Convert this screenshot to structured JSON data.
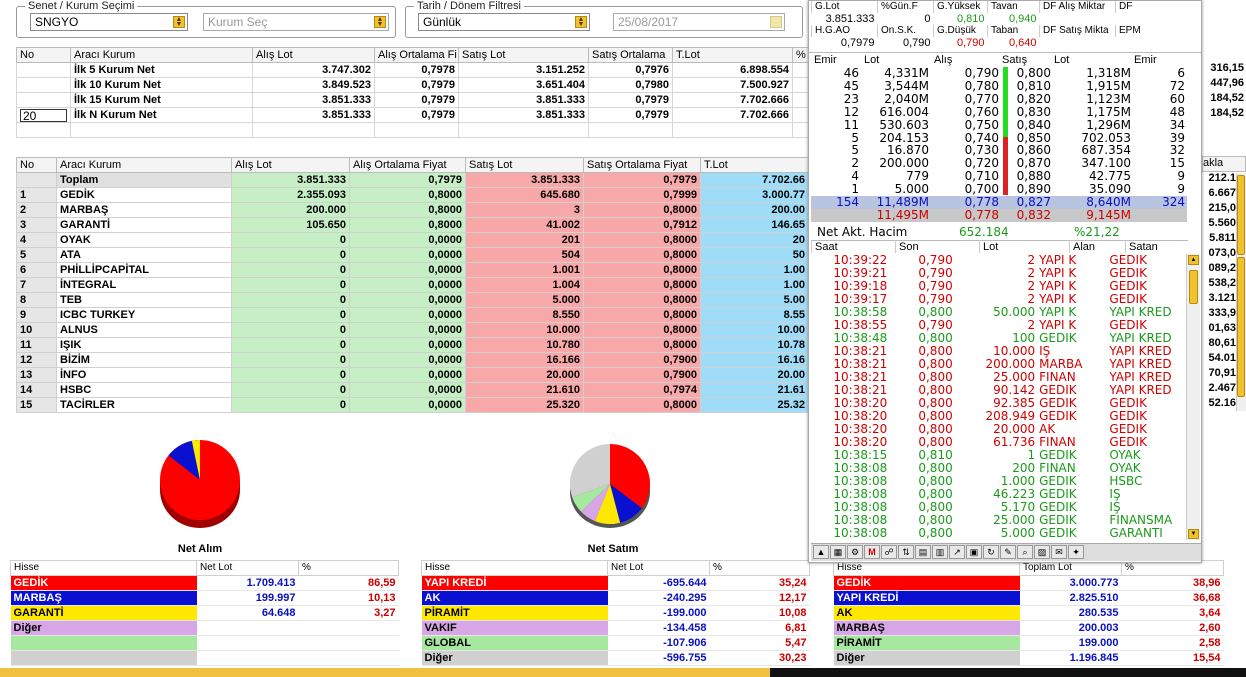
{
  "filters": {
    "senet_legend": "Senet / Kurum Seçimi",
    "senet_value": "SNGYO",
    "kurum_placeholder": "Kurum Seç",
    "tarih_legend": "Tarih / Dönem Filtresi",
    "period_value": "Günlük",
    "date_value": "25/08/2017"
  },
  "top_table": {
    "headers": [
      "No",
      "Aracı Kurum",
      "Alış Lot",
      "Alış Ortalama Fi",
      "Satış Lot",
      "Satış Ortalama",
      "T.Lot",
      "%"
    ],
    "n_input": "20",
    "rows": [
      {
        "no": "",
        "name": "İlk 5 Kurum Net",
        "al": "3.747.302",
        "alo": "0,7978",
        "sat": "3.151.252",
        "sato": "0,7976",
        "tlot": "6.898.554"
      },
      {
        "no": "",
        "name": "İlk 10 Kurum Net",
        "al": "3.849.523",
        "alo": "0,7979",
        "sat": "3.651.404",
        "sato": "0,7980",
        "tlot": "7.500.927"
      },
      {
        "no": "",
        "name": "İlk 15 Kurum Net",
        "al": "3.851.333",
        "alo": "0,7979",
        "sat": "3.851.333",
        "sato": "0,7979",
        "tlot": "7.702.666"
      },
      {
        "no": "",
        "name": "İlk N Kurum Net",
        "al": "3.851.333",
        "alo": "0,7979",
        "sat": "3.851.333",
        "sato": "0,7979",
        "tlot": "7.702.666"
      }
    ]
  },
  "mid_table": {
    "headers": [
      "No",
      "Aracı Kurum",
      "Alış Lot",
      "Alış Ortalama Fiyat",
      "Satış Lot",
      "Satış Ortalama Fiyat",
      "T.Lot"
    ],
    "rows": [
      {
        "no": "",
        "name": "Toplam",
        "al": "3.851.333",
        "alo": "0,7979",
        "sat": "3.851.333",
        "sato": "0,7979",
        "tlot": "7.702.66"
      },
      {
        "no": "1",
        "name": "GEDİK",
        "al": "2.355.093",
        "alo": "0,8000",
        "sat": "645.680",
        "sato": "0,7999",
        "tlot": "3.000.77"
      },
      {
        "no": "2",
        "name": "MARBAŞ",
        "al": "200.000",
        "alo": "0,8000",
        "sat": "3",
        "sato": "0,8000",
        "tlot": "200.00"
      },
      {
        "no": "3",
        "name": "GARANTİ",
        "al": "105.650",
        "alo": "0,8000",
        "sat": "41.002",
        "sato": "0,7912",
        "tlot": "146.65"
      },
      {
        "no": "4",
        "name": "OYAK",
        "al": "0",
        "alo": "0,0000",
        "sat": "201",
        "sato": "0,8000",
        "tlot": "20"
      },
      {
        "no": "5",
        "name": "ATA",
        "al": "0",
        "alo": "0,0000",
        "sat": "504",
        "sato": "0,8000",
        "tlot": "50"
      },
      {
        "no": "6",
        "name": "PHİLLİPCAPİTAL",
        "al": "0",
        "alo": "0,0000",
        "sat": "1.001",
        "sato": "0,8000",
        "tlot": "1.00"
      },
      {
        "no": "7",
        "name": "İNTEGRAL",
        "al": "0",
        "alo": "0,0000",
        "sat": "1.004",
        "sato": "0,8000",
        "tlot": "1.00"
      },
      {
        "no": "8",
        "name": "TEB",
        "al": "0",
        "alo": "0,0000",
        "sat": "5.000",
        "sato": "0,8000",
        "tlot": "5.00"
      },
      {
        "no": "9",
        "name": "ICBC TURKEY",
        "al": "0",
        "alo": "0,0000",
        "sat": "8.550",
        "sato": "0,8000",
        "tlot": "8.55"
      },
      {
        "no": "10",
        "name": "ALNUS",
        "al": "0",
        "alo": "0,0000",
        "sat": "10.000",
        "sato": "0,8000",
        "tlot": "10.00"
      },
      {
        "no": "11",
        "name": "IŞIK",
        "al": "0",
        "alo": "0,0000",
        "sat": "10.780",
        "sato": "0,8000",
        "tlot": "10.78"
      },
      {
        "no": "12",
        "name": "BİZİM",
        "al": "0",
        "alo": "0,0000",
        "sat": "16.166",
        "sato": "0,7900",
        "tlot": "16.16"
      },
      {
        "no": "13",
        "name": "İNFO",
        "al": "0",
        "alo": "0,0000",
        "sat": "20.000",
        "sato": "0,7900",
        "tlot": "20.00"
      },
      {
        "no": "14",
        "name": "HSBC",
        "al": "0",
        "alo": "0,0000",
        "sat": "21.610",
        "sato": "0,7974",
        "tlot": "21.61"
      },
      {
        "no": "15",
        "name": "TACİRLER",
        "al": "0",
        "alo": "0,0000",
        "sat": "25.320",
        "sato": "0,8000",
        "tlot": "25.32"
      }
    ]
  },
  "right_clip": {
    "top": [
      "316,15",
      "447,96",
      "184,52",
      "184,52"
    ],
    "mid_header": "akla",
    "mid": [
      "212.1",
      "6.667",
      "215,0",
      "5.560",
      "5.811",
      "073,0",
      "089,2",
      "538,2",
      "3.121",
      "333,9",
      "01,63",
      "80,61",
      "54.01",
      "70,91",
      "2.467",
      "52.16"
    ]
  },
  "pies": {
    "alim_label": "Net Alım",
    "satim_label": "Net Satım"
  },
  "alim_table": {
    "headers": [
      "Hisse",
      "Net Lot",
      "%"
    ],
    "rows": [
      {
        "name": "GEDİK",
        "lot": "1.709.413",
        "pct": "86,59",
        "sw": "red"
      },
      {
        "name": "MARBAŞ",
        "lot": "199.997",
        "pct": "10,13",
        "sw": "blue"
      },
      {
        "name": "GARANTİ",
        "lot": "64.648",
        "pct": "3,27",
        "sw": "yel"
      },
      {
        "name": "Diğer",
        "lot": "",
        "pct": "",
        "sw": "lav"
      },
      {
        "name": "",
        "lot": "",
        "pct": "",
        "sw": "grn"
      },
      {
        "name": "",
        "lot": "",
        "pct": "",
        "sw": "gry"
      }
    ]
  },
  "satim_table": {
    "headers": [
      "Hisse",
      "Net Lot",
      "%"
    ],
    "rows": [
      {
        "name": "YAPI KREDİ",
        "lot": "-695.644",
        "pct": "35,24",
        "sw": "red"
      },
      {
        "name": "AK",
        "lot": "-240.295",
        "pct": "12,17",
        "sw": "blue"
      },
      {
        "name": "PİRAMİT",
        "lot": "-199.000",
        "pct": "10,08",
        "sw": "yel"
      },
      {
        "name": "VAKIF",
        "lot": "-134.458",
        "pct": "6,81",
        "sw": "lav"
      },
      {
        "name": "GLOBAL",
        "lot": "-107.906",
        "pct": "5,47",
        "sw": "grn"
      },
      {
        "name": "Diğer",
        "lot": "-596.755",
        "pct": "30,23",
        "sw": "gry"
      }
    ]
  },
  "toplam_table": {
    "headers": [
      "Hisse",
      "Toplam Lot",
      "%"
    ],
    "rows": [
      {
        "name": "GEDİK",
        "lot": "3.000.773",
        "pct": "38,96",
        "sw": "red"
      },
      {
        "name": "YAPI KREDİ",
        "lot": "2.825.510",
        "pct": "36,68",
        "sw": "blue"
      },
      {
        "name": "AK",
        "lot": "280.535",
        "pct": "3,64",
        "sw": "yel"
      },
      {
        "name": "MARBAŞ",
        "lot": "200.003",
        "pct": "2,60",
        "sw": "lav"
      },
      {
        "name": "PİRAMİT",
        "lot": "199.000",
        "pct": "2,58",
        "sw": "grn"
      },
      {
        "name": "Diğer",
        "lot": "1.196.845",
        "pct": "15,54",
        "sw": "gry"
      }
    ]
  },
  "panel": {
    "info_headers1": [
      "G.Lot",
      "%Gün.F",
      "G.Yüksek",
      "Tavan",
      "DF Alış Miktar",
      "DF"
    ],
    "info_values1": [
      "3.851.333",
      "0",
      "0,810",
      "0,940",
      "",
      ""
    ],
    "info_headers2": [
      "H.G.AO",
      "On.S.K.",
      "G.Düşük",
      "Taban",
      "DF Satış Mikta",
      "EPM"
    ],
    "info_values2": [
      "0,7979",
      "0,790",
      "0,790",
      "0,640",
      "",
      ""
    ],
    "ob_headers": [
      "Emir",
      "Lot",
      "Alış",
      "Satış",
      "Lot",
      "Emir"
    ],
    "ob_rows": [
      [
        "46",
        "4,331M",
        "0,790",
        "0,800",
        "1,318M",
        "6"
      ],
      [
        "45",
        "3,544M",
        "0,780",
        "0,810",
        "1,915M",
        "72"
      ],
      [
        "23",
        "2,040M",
        "0,770",
        "0,820",
        "1,123M",
        "60"
      ],
      [
        "12",
        "616.004",
        "0,760",
        "0,830",
        "1,175M",
        "48"
      ],
      [
        "11",
        "530.603",
        "0,750",
        "0,840",
        "1,296M",
        "34"
      ],
      [
        "5",
        "204.153",
        "0,740",
        "0,850",
        "702.053",
        "39"
      ],
      [
        "5",
        "16.870",
        "0,730",
        "0,860",
        "687.354",
        "32"
      ],
      [
        "2",
        "200.000",
        "0,720",
        "0,870",
        "347.100",
        "15"
      ],
      [
        "4",
        "779",
        "0,710",
        "0,880",
        "42.775",
        "9"
      ],
      [
        "1",
        "5.000",
        "0,700",
        "0,890",
        "35.090",
        "9"
      ]
    ],
    "ob_total": [
      "154",
      "11,489M",
      "0,778",
      "0,827",
      "8,640M",
      "324"
    ],
    "ob_total2": [
      "",
      "11,495M",
      "0,778",
      "0,832",
      "9,145M",
      ""
    ],
    "net_label": "Net Akt. Hacim",
    "net_value": "652.184",
    "net_pct": "%21,22",
    "tape_headers": [
      "Saat",
      "Son",
      "Lot",
      "Alan",
      "Satan"
    ],
    "tape": [
      [
        "10:39:22",
        "0,790",
        "2",
        "YAPI K",
        "GEDİK",
        "red"
      ],
      [
        "10:39:21",
        "0,790",
        "2",
        "YAPI K",
        "GEDİK",
        "red"
      ],
      [
        "10:39:18",
        "0,790",
        "2",
        "YAPI K",
        "GEDİK",
        "red"
      ],
      [
        "10:39:17",
        "0,790",
        "2",
        "YAPI K",
        "GEDİK",
        "red"
      ],
      [
        "10:38:58",
        "0,800",
        "50.000",
        "YAPI K",
        "YAPI KRED",
        "green"
      ],
      [
        "10:38:55",
        "0,790",
        "2",
        "YAPI K",
        "GEDİK",
        "red"
      ],
      [
        "10:38:48",
        "0,800",
        "100",
        "GEDİK",
        "YAPI KRED",
        "green"
      ],
      [
        "10:38:21",
        "0,800",
        "10.000",
        "İŞ",
        "YAPI KRED",
        "red"
      ],
      [
        "10:38:21",
        "0,800",
        "200.000",
        "MARBA",
        "YAPI KRED",
        "red"
      ],
      [
        "10:38:21",
        "0,800",
        "25.000",
        "FİNAN",
        "YAPI KRED",
        "red"
      ],
      [
        "10:38:21",
        "0,800",
        "90.142",
        "GEDİK",
        "YAPI KRED",
        "red"
      ],
      [
        "10:38:20",
        "0,800",
        "92.385",
        "GEDİK",
        "GEDİK",
        "red"
      ],
      [
        "10:38:20",
        "0,800",
        "208.949",
        "GEDİK",
        "GEDİK",
        "red"
      ],
      [
        "10:38:20",
        "0,800",
        "20.000",
        "AK",
        "GEDİK",
        "red"
      ],
      [
        "10:38:20",
        "0,800",
        "61.736",
        "FİNAN",
        "GEDİK",
        "red"
      ],
      [
        "10:38:15",
        "0,810",
        "1",
        "GEDİK",
        "OYAK",
        "green"
      ],
      [
        "10:38:08",
        "0,800",
        "200",
        "FİNAN",
        "OYAK",
        "green"
      ],
      [
        "10:38:08",
        "0,800",
        "1.000",
        "GEDİK",
        "HSBC",
        "green"
      ],
      [
        "10:38:08",
        "0,800",
        "46.223",
        "GEDİK",
        "İŞ",
        "green"
      ],
      [
        "10:38:08",
        "0,800",
        "5.170",
        "GEDİK",
        "İŞ",
        "green"
      ],
      [
        "10:38:08",
        "0,800",
        "25.000",
        "GEDİK",
        "FİNANSMA",
        "green"
      ],
      [
        "10:38:08",
        "0,800",
        "5.000",
        "GEDİK",
        "GARANTİ",
        "green"
      ]
    ]
  }
}
